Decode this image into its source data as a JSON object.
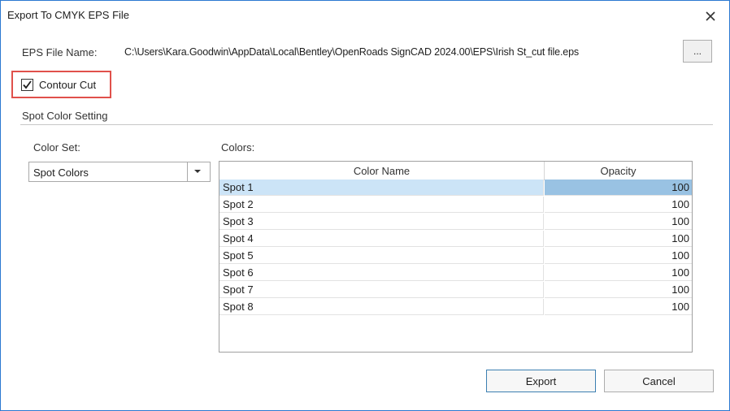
{
  "window": {
    "title": "Export To CMYK EPS File",
    "close_icon": "close-icon"
  },
  "file": {
    "label": "EPS File Name:",
    "path": "C:\\Users\\Kara.Goodwin\\AppData\\Local\\Bentley\\OpenRoads SignCAD 2024.00\\EPS\\Irish St_cut file.eps",
    "browse_label": "..."
  },
  "contour_cut": {
    "label": "Contour Cut",
    "checked": true,
    "highlight_color": "#e0514b"
  },
  "spot_section": {
    "title": "Spot Color Setting"
  },
  "color_set": {
    "label": "Color Set:",
    "value": "Spot Colors"
  },
  "colors": {
    "label": "Colors:",
    "columns": [
      "Color Name",
      "Opacity"
    ],
    "rows": [
      {
        "name": "Spot 1",
        "opacity": "100",
        "selected": true
      },
      {
        "name": "Spot 2",
        "opacity": "100"
      },
      {
        "name": "Spot 3",
        "opacity": "100"
      },
      {
        "name": "Spot 4",
        "opacity": "100"
      },
      {
        "name": "Spot 5",
        "opacity": "100"
      },
      {
        "name": "Spot 6",
        "opacity": "100"
      },
      {
        "name": "Spot 7",
        "opacity": "100"
      },
      {
        "name": "Spot 8",
        "opacity": "100"
      }
    ]
  },
  "buttons": {
    "export": "Export",
    "cancel": "Cancel"
  },
  "colors_theme": {
    "accent": "#2b79d1",
    "selection": "#cce4f7",
    "selection_strong": "#99c2e3"
  }
}
